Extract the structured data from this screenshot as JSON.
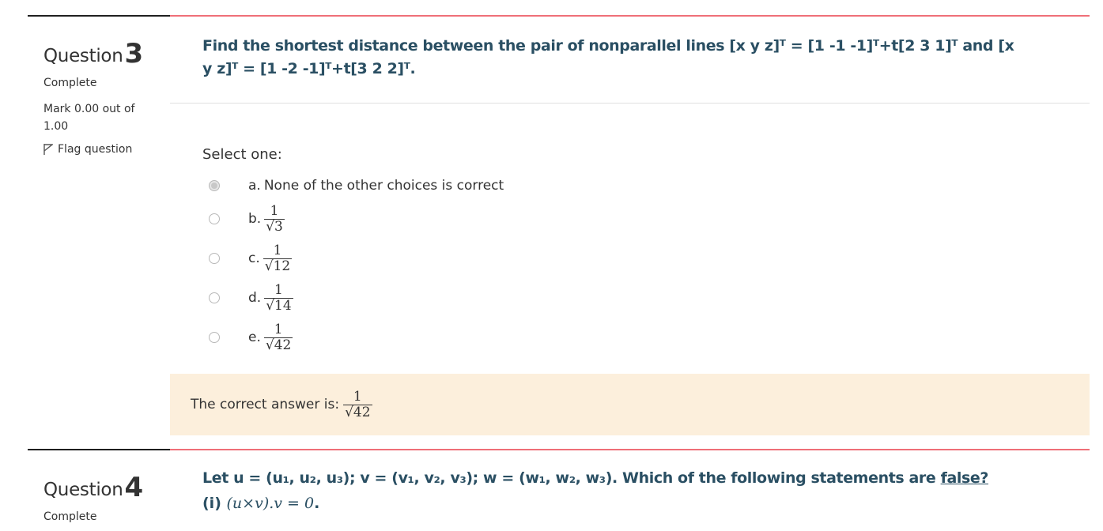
{
  "question3": {
    "label": "Question",
    "number": "3",
    "state": "Complete",
    "grade": "Mark 0.00 out of 1.00",
    "flag_label": "Flag question",
    "text": "Find the shortest distance between the pair of nonparallel lines [x  y  z]ᵀ = [1 -1 -1]ᵀ+t[2 3 1]ᵀ and [x  y  z]ᵀ = [1 -2 -1]ᵀ+t[3 2 2]ᵀ.",
    "prompt": "Select one:",
    "options": [
      {
        "letter": "a.",
        "text": "None of the other choices is correct",
        "selected": true
      },
      {
        "letter": "b.",
        "num": "1",
        "den": "√3",
        "selected": false
      },
      {
        "letter": "c.",
        "num": "1",
        "den": "√12",
        "selected": false
      },
      {
        "letter": "d.",
        "num": "1",
        "den": "√14",
        "selected": false
      },
      {
        "letter": "e.",
        "num": "1",
        "den": "√42",
        "selected": false
      }
    ],
    "feedback_label": "The correct answer is:",
    "feedback_num": "1",
    "feedback_den": "√42"
  },
  "question4": {
    "label": "Question",
    "number": "4",
    "state": "Complete",
    "text_prefix": "Let u = (u₁, u₂, u₃); v = (v₁, v₂, v₃); w = (w₁, w₂, w₃). Which of the following statements are ",
    "text_emph": "false?",
    "statement_label": "(i)",
    "statement_math": "(u×v).v = 0",
    "statement_end": "."
  },
  "colors": {
    "accent": "#ef6f78",
    "question_text": "#2a4f63",
    "feedback_bg": "#fcefdc"
  }
}
